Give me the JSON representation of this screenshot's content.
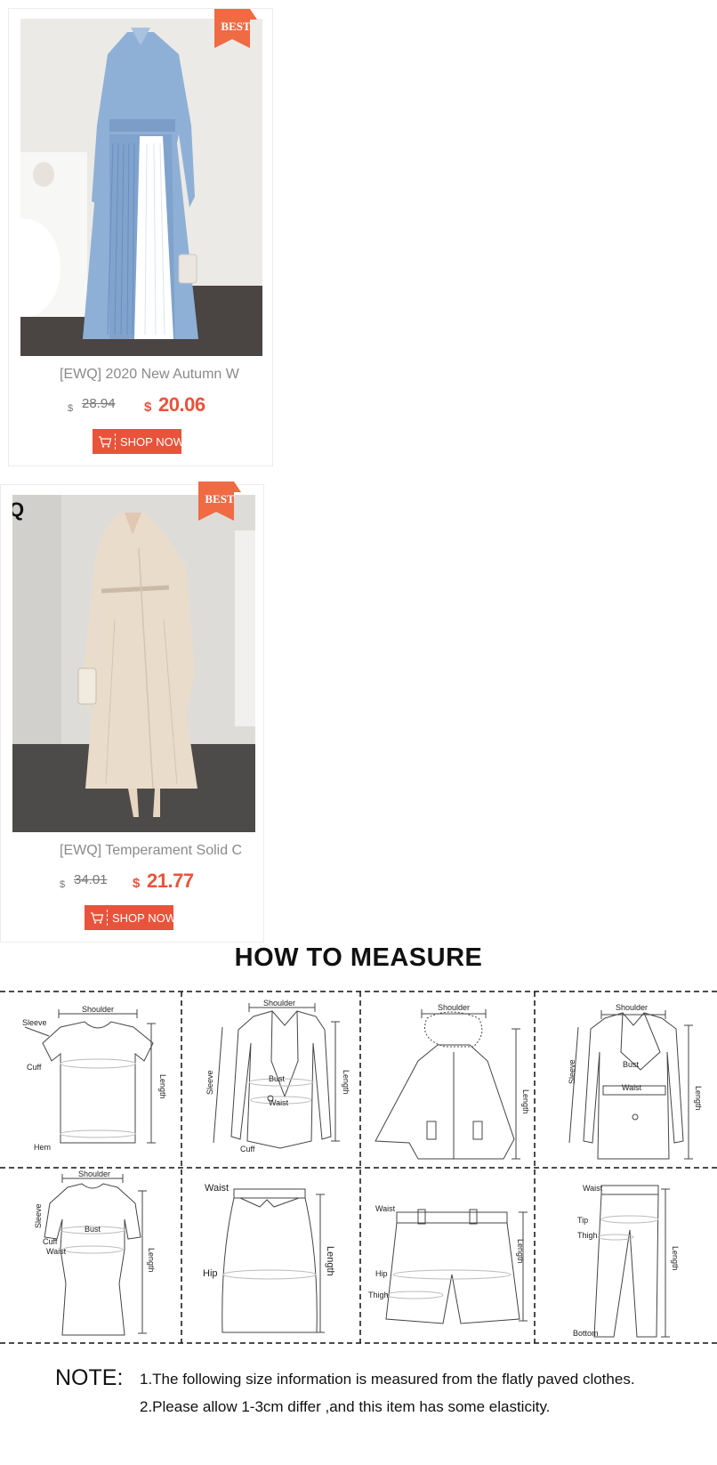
{
  "products": [
    {
      "badge": "BEST",
      "title": "[EWQ]  2020 New Autumn W",
      "currency": "$",
      "old_price": "28.94",
      "new_price": "20.06",
      "button": "SHOP NOW"
    },
    {
      "badge": "BEST",
      "title": "[EWQ] Temperament Solid C",
      "currency": "$",
      "old_price": "34.01",
      "new_price": "21.77",
      "button": "SHOP NOW"
    }
  ],
  "brand_mark": "Q",
  "measure": {
    "title": "HOW TO MEASURE",
    "labels": {
      "shoulder": "Shoulder",
      "sleeve": "Sleeve",
      "cuff": "Cuff",
      "hem": "Hem",
      "length": "Length",
      "bust": "Bust",
      "waist": "Waist",
      "hip": "Hip",
      "thigh": "Thigh",
      "tip": "Tip",
      "bottom": "Bottom"
    }
  },
  "note": {
    "head": "NOTE:",
    "line1": "1.The following size information is measured from the flatly paved clothes.",
    "line2": "2.Please allow 1-3cm differ ,and this item has some elasticity."
  },
  "colors": {
    "accent": "#e8533b",
    "dress1_blue": "#8fb0d6",
    "dress2_beige": "#e9dccb"
  }
}
